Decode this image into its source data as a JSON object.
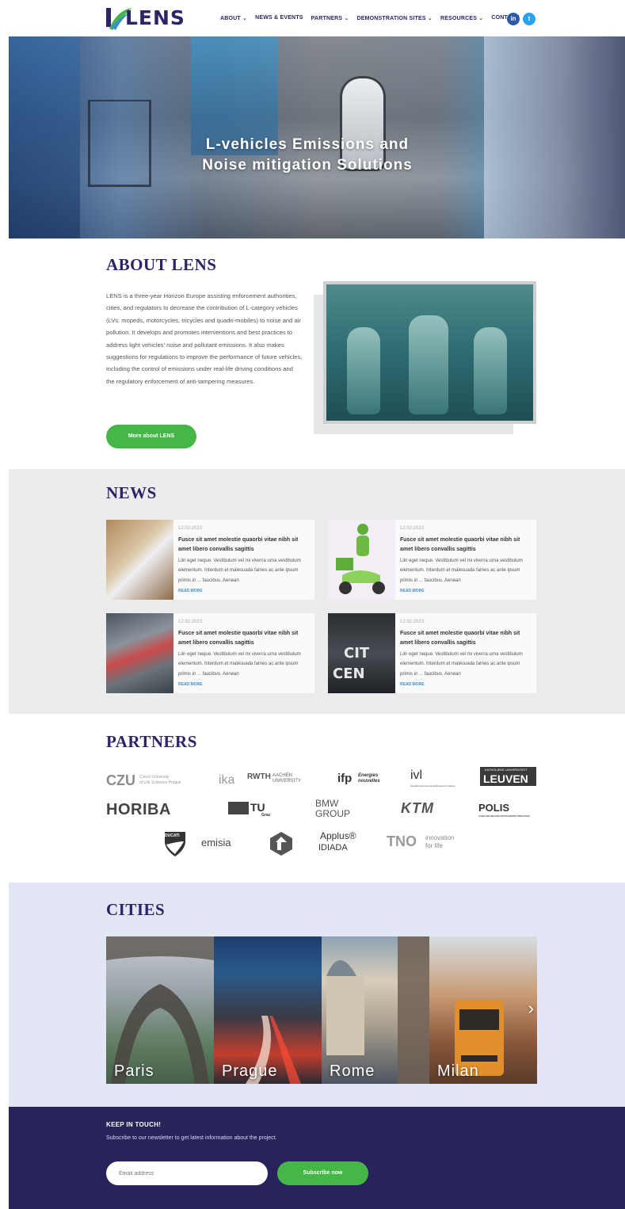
{
  "header": {
    "logo_text": "LENS",
    "nav": [
      {
        "label": "ABOUT ⌄"
      },
      {
        "label": "NEWS & EVENTS"
      },
      {
        "label": "PARTNERS ⌄"
      },
      {
        "label": "DEMONSTRATION SITES ⌄"
      },
      {
        "label": "RESOURCES ⌄"
      },
      {
        "label": "CONTACT"
      }
    ],
    "social": {
      "linkedin": "in",
      "twitter": "t"
    }
  },
  "hero": {
    "title_line1": "L-vehicles Emissions and",
    "title_line2": "Noise mitigation Solutions"
  },
  "about": {
    "title": "ABOUT LENS",
    "text": "LENS is a three-year Horizon Europe assisting enforcement authorities, cities, and regulators to decrease the contribution of L-category vehicles (LVs: mopeds, motorcycles, tricycles and quadri-mobiles) to noise and air pollution. It develops and promotes interventions and best practices to address light vehicles' noise and pollutant emissions. It also makes suggestions for regulations to improve the performance of future vehicles, including the control of emissions under real-life driving conditions and the regulatory enforcement of anti-tampering measures.",
    "button": "More about LENS"
  },
  "news": {
    "title": "NEWS",
    "items": [
      {
        "date": "12.02.2023",
        "headline": "Fusce sit amet molestie quaorbi vitae nibh sit amet libero convallis sagittis",
        "excerpt": "Liin eget neque. Vestibulum vel mi viverra urna vestibulum elementum. Interdum et malesuada fames ac ante ipsum primis in ... faucibus. Aenean",
        "more": "READ MORE"
      },
      {
        "date": "12.02.2023",
        "headline": "Fusce sit amet molestie quaorbi vitae nibh sit amet libero convallis sagittis",
        "excerpt": "Liin eget neque. Vestibulum vel mi viverra urna vestibulum elementum. Interdum et malesuada fames ac ante ipsum primis in ... faucibus. Aenean",
        "more": "READ MORE"
      },
      {
        "date": "12.02.2023",
        "headline": "Fusce sit amet molestie quaorbi vitae nibh sit amet libero convallis sagittis",
        "excerpt": "Liin eget neque. Vestibulum vel mi viverra urna vestibulum elementum. Interdum et malesuada fames ac ante ipsum primis in ... faucibus. Aenean",
        "more": "READ MORE"
      },
      {
        "date": "12.02.2023",
        "headline": "Fusce sit amet molestie quaorbi vitae nibh sit amet libero convallis sagittis",
        "excerpt": "Liin eget neque. Vestibulum vel mi viverra urna vestibulum elementum. Interdum et malesuada fames ac ante ipsum primis in ... faucibus. Aenean",
        "more": "READ MORE"
      }
    ]
  },
  "partners": {
    "title": "PARTNERS",
    "logos": {
      "czu": "CZU",
      "czu_sub1": "Czech University",
      "czu_sub2": "of Life Sciences Prague",
      "ika": "ika",
      "rwth": "RWTH",
      "rwth_sub1": "AACHEN",
      "rwth_sub2": "UNIVERSITY",
      "ifp": "ifp",
      "ifp_sub1": "Energies",
      "ifp_sub2": "nouvelles",
      "ivl": "ivl",
      "ivl_sub": "Swedish Environmental Research Institute",
      "leuven_sub": "KATHOLIEKE UNIVERSITEIT",
      "leuven": "LEUVEN",
      "horiba": "HORIBA",
      "tu": "TU",
      "tu_sub": "Graz",
      "bmw1": "BMW",
      "bmw2": "GROUP",
      "ktm": "KTM",
      "polis": "POLIS",
      "polis_sub": "CITIES AND REGIONS FOR TRANSPORT INNOVATION",
      "ducati": "DUCATI",
      "emisia": "emisia",
      "applus": "Applus®",
      "idiada": "IDIADA",
      "tno": "TNO",
      "tno_sub1": "innovation",
      "tno_sub2": "for life"
    }
  },
  "cities": {
    "title": "CITIES",
    "items": [
      {
        "name": "Paris"
      },
      {
        "name": "Prague"
      },
      {
        "name": "Rome"
      },
      {
        "name": "Milan"
      }
    ],
    "next_arrow": "›"
  },
  "footer": {
    "heading": "KEEP IN TOUCH!",
    "text": "Subscribe to our newsletter to get latest information about the project.",
    "email_placeholder": "Email address",
    "button": "Subscribe now"
  }
}
